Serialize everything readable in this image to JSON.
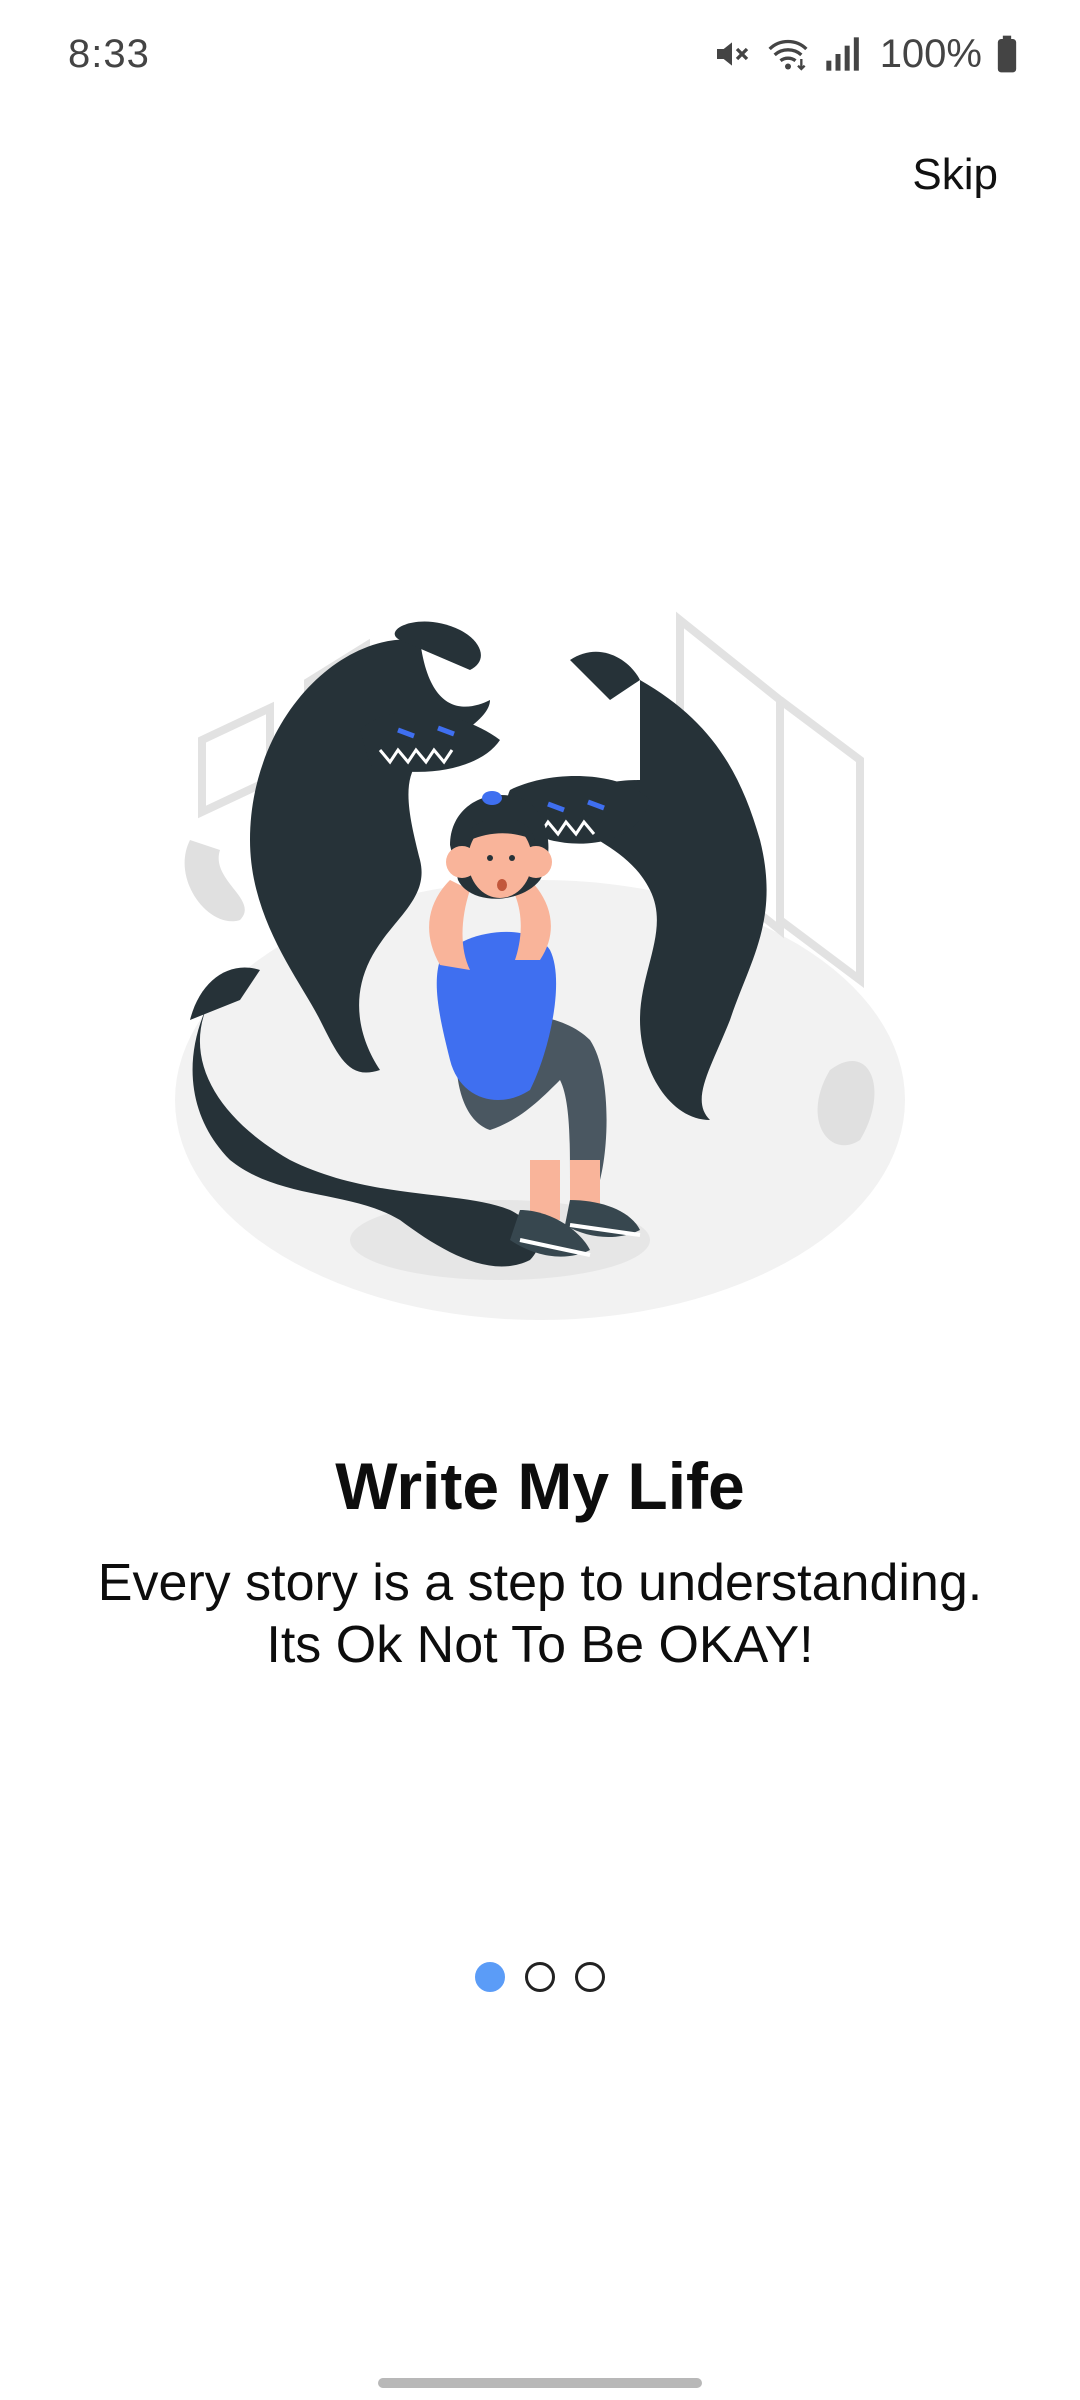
{
  "status_bar": {
    "time": "8:33",
    "battery": "100%",
    "icons": [
      "mute-icon",
      "wifi-icon",
      "signal-icon",
      "battery-icon"
    ]
  },
  "skip_label": "Skip",
  "illustration": {
    "icon": "anxiety-illustration",
    "accent_color": "#3f6ff0",
    "shadow_color": "#263238"
  },
  "onboarding": {
    "title": "Write My Life",
    "subtitle_line1": "Every story is a step to understanding.",
    "subtitle_line2": "Its Ok Not To Be OKAY!"
  },
  "pager": {
    "active_color": "#5b9cf7",
    "current_page": 1,
    "total_pages": 3
  }
}
